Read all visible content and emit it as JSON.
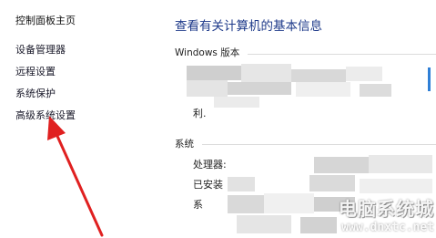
{
  "sidebar": {
    "title": "控制面板主页",
    "links": [
      {
        "label": "设备管理器"
      },
      {
        "label": "远程设置"
      },
      {
        "label": "系统保护"
      },
      {
        "label": "高级系统设置"
      }
    ]
  },
  "main": {
    "title": "查看有关计算机的基本信息",
    "windows_section": {
      "label": "Windows 版本",
      "partial_text": "利."
    },
    "system_section": {
      "label": "系统",
      "fields": [
        {
          "label": "处理器:"
        },
        {
          "label": "已安装"
        },
        {
          "label": "系"
        }
      ]
    }
  },
  "watermark": {
    "title": "电脑系统城",
    "url": "www.dnxtc.net"
  },
  "colors": {
    "title_blue": "#1e3a8a",
    "arrow_red": "#e02020",
    "accent_blue": "#2f7fd6"
  }
}
